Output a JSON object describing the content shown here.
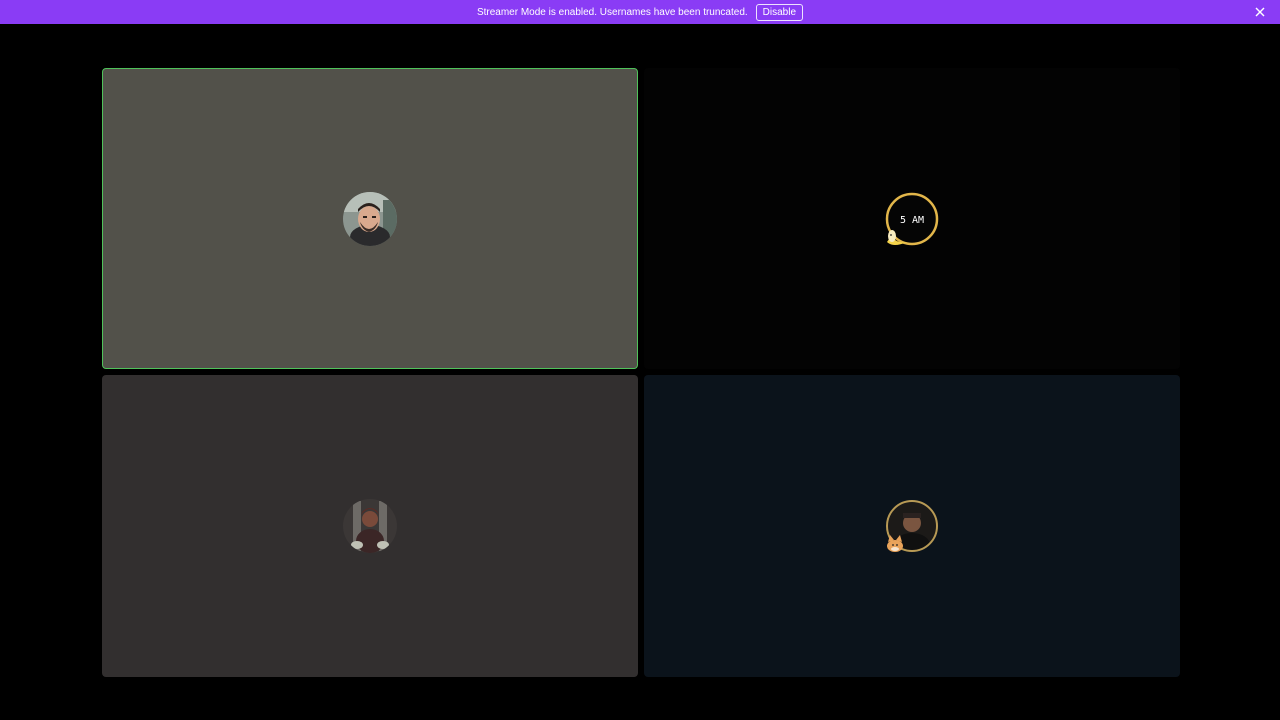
{
  "banner": {
    "message": "Streamer Mode is enabled. Usernames have been truncated.",
    "disable_label": "Disable",
    "color": "#8a3cf5"
  },
  "participants": [
    {
      "avatar_icon": "user-webcam-avatar-icon",
      "speaking": true,
      "tile_color": "#52514a"
    },
    {
      "avatar_icon": "banana-clock-avatar-icon",
      "avatar_text": "5 AM",
      "speaking": false,
      "tile_color": "#030303"
    },
    {
      "avatar_icon": "character-avatar-icon",
      "speaking": false,
      "tile_color": "#322f2f"
    },
    {
      "avatar_icon": "cat-frame-avatar-icon",
      "speaking": false,
      "tile_color": "#0b131b"
    }
  ],
  "colors": {
    "speaking_border": "#4fc25a",
    "background": "#000000"
  }
}
